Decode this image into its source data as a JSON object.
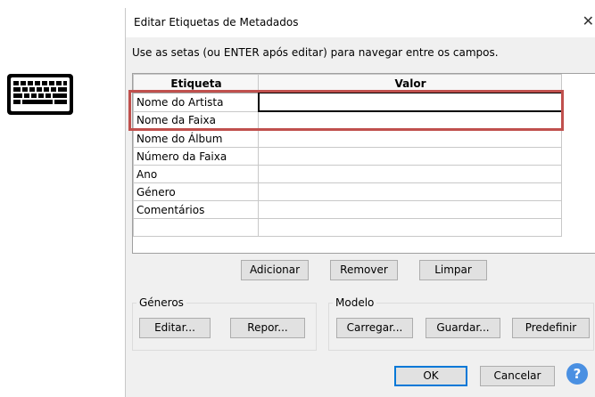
{
  "dialog": {
    "title": "Editar Etiquetas de Metadados",
    "close_glyph": "✕",
    "instruction": "Use as setas (ou ENTER após editar) para navegar entre os campos."
  },
  "table": {
    "headers": [
      "Etiqueta",
      "Valor"
    ],
    "rows": [
      {
        "label": "Nome do Artista",
        "value": ""
      },
      {
        "label": "Nome da Faixa",
        "value": ""
      },
      {
        "label": "Nome do Álbum",
        "value": ""
      },
      {
        "label": "Número da Faixa",
        "value": ""
      },
      {
        "label": "Ano",
        "value": ""
      },
      {
        "label": "Género",
        "value": ""
      },
      {
        "label": "Comentários",
        "value": ""
      },
      {
        "label": "",
        "value": ""
      }
    ]
  },
  "buttons": {
    "add": "Adicionar",
    "remove": "Remover",
    "clear": "Limpar",
    "edit": "Editar...",
    "reset": "Repor...",
    "load": "Carregar...",
    "save": "Guardar...",
    "default": "Predefinir",
    "ok": "OK",
    "cancel": "Cancelar"
  },
  "groups": {
    "genres": "Géneros",
    "template": "Modelo"
  },
  "help_glyph": "?",
  "icons": {
    "keyboard": "keyboard-icon",
    "help": "help-icon",
    "close": "close-icon"
  },
  "colors": {
    "highlight": "#c0504d",
    "help": "#4a90e2"
  }
}
